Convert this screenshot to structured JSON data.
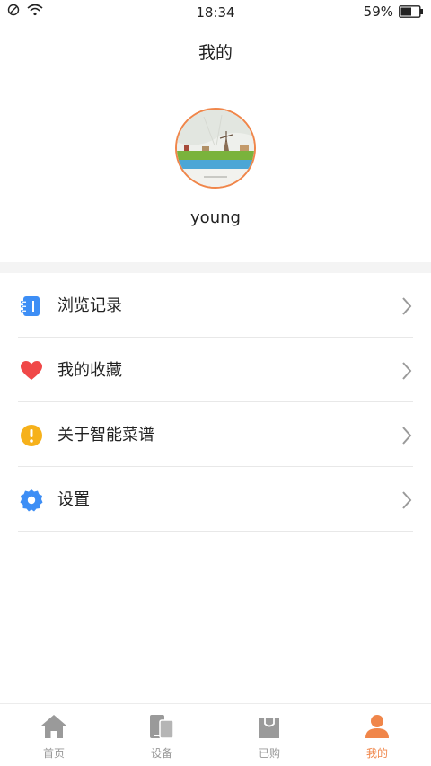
{
  "status_bar": {
    "time": "18:34",
    "battery_percent": "59%",
    "battery_level": 0.59
  },
  "header": {
    "title": "我的"
  },
  "profile": {
    "username": "young"
  },
  "menu": {
    "items": [
      {
        "label": "浏览记录",
        "icon": "history-icon",
        "color": "#3d8ef5"
      },
      {
        "label": "我的收藏",
        "icon": "heart-icon",
        "color": "#f04848"
      },
      {
        "label": "关于智能菜谱",
        "icon": "info-icon",
        "color": "#f6b11b"
      },
      {
        "label": "设置",
        "icon": "gear-icon",
        "color": "#3d8ef5"
      }
    ]
  },
  "tabbar": {
    "tabs": [
      {
        "label": "首页",
        "icon": "home-icon",
        "active": false
      },
      {
        "label": "设备",
        "icon": "devices-icon",
        "active": false
      },
      {
        "label": "已购",
        "icon": "shopping-bag-icon",
        "active": false
      },
      {
        "label": "我的",
        "icon": "person-icon",
        "active": true
      }
    ],
    "active_color": "#f0864a",
    "inactive_color": "#999999"
  }
}
